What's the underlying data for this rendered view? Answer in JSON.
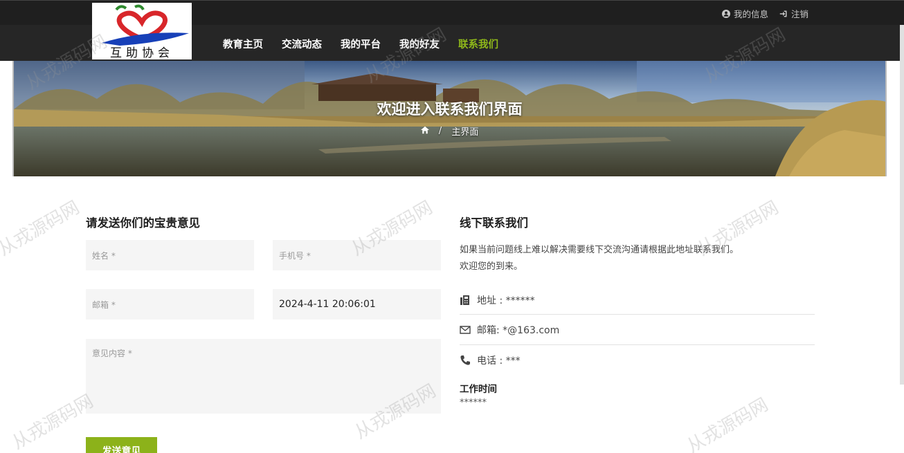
{
  "topbar": {
    "my_info": "我的信息",
    "logout": "注销"
  },
  "logo": {
    "text": "互助协会"
  },
  "nav": {
    "items": [
      "教育主页",
      "交流动态",
      "我的平台",
      "我的好友",
      "联系我们"
    ],
    "active": "联系我们",
    "active_color": "#8fb91a"
  },
  "banner": {
    "title": "欢迎进入联系我们界面",
    "breadcrumb": "主界面"
  },
  "form": {
    "title": "请发送你们的宝贵意见",
    "name_placeholder": "姓名 *",
    "phone_placeholder": "手机号 *",
    "email_placeholder": "邮箱 *",
    "datetime_value": "2024-4-11 20:06:01",
    "message_placeholder": "意见内容 *",
    "submit_label": "发送意见",
    "submit_color": "#8cb21a"
  },
  "contact": {
    "title": "线下联系我们",
    "desc_line1": "如果当前问题线上难以解决需要线下交流沟通请根据此地址联系我们。",
    "desc_line2": "欢迎您的到来。",
    "address": "地址 : ******",
    "email": "邮箱: *@163.com",
    "phone": "电话 : ***",
    "work_title": "工作时间",
    "work_value": "******"
  },
  "watermark": "从戎源码网"
}
